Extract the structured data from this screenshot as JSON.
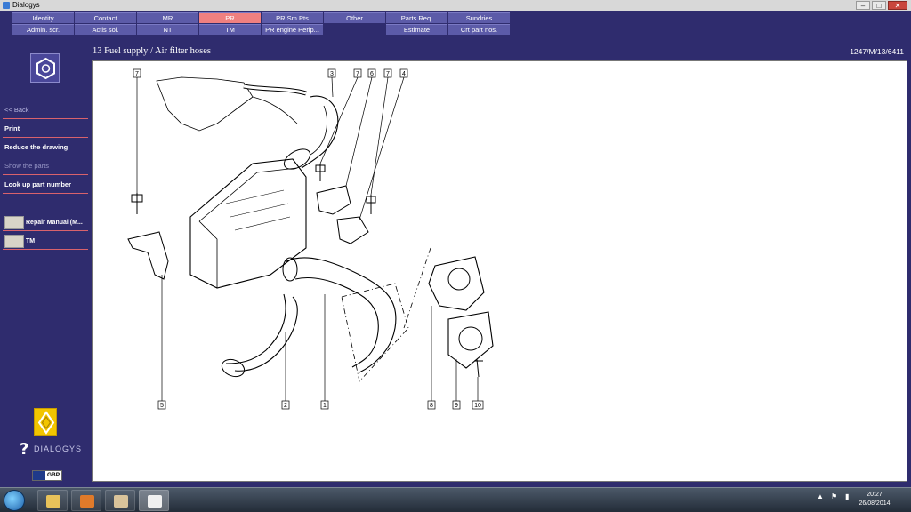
{
  "window": {
    "title": "Dialogys",
    "controls": [
      "–",
      "□",
      "✕"
    ]
  },
  "menu": {
    "row1": [
      {
        "label": "Identity",
        "active": false
      },
      {
        "label": "Contact",
        "active": false
      },
      {
        "label": "MR",
        "active": false
      },
      {
        "label": "PR",
        "active": true
      },
      {
        "label": "PR Sm Pts",
        "active": false
      },
      {
        "label": "Other",
        "active": false
      },
      {
        "label": "Parts Req.",
        "active": false
      },
      {
        "label": "Sundries",
        "active": false
      }
    ],
    "row2": [
      {
        "label": "Admin. scr."
      },
      {
        "label": "Actis sol."
      },
      {
        "label": "NT"
      },
      {
        "label": "TM"
      },
      {
        "label": "PR engine Perip..."
      },
      {
        "label": ""
      },
      {
        "label": "Estimate"
      },
      {
        "label": "Crt part nos."
      }
    ]
  },
  "sidebar": {
    "logo_icon": "hexagon-bolt-icon",
    "items": [
      {
        "label": "<< Back",
        "state": "back"
      },
      {
        "label": "Print",
        "state": "enabled"
      },
      {
        "label": "Reduce the drawing",
        "state": "enabled"
      },
      {
        "label": "Show the parts",
        "state": "disabled"
      },
      {
        "label": "Look up part number",
        "state": "enabled"
      }
    ],
    "tools": [
      {
        "label": "Repair Manual (M...",
        "icon": "repair-manual-icon"
      },
      {
        "label": "TM",
        "icon": "tm-icon"
      }
    ]
  },
  "header": {
    "title": "13 Fuel supply / Air filter hoses",
    "reference": "1247/M/13/6411"
  },
  "drawing": {
    "callouts_top": [
      "7",
      "3",
      "7",
      "6",
      "7",
      "4"
    ],
    "callouts_bottom": [
      "5",
      "2",
      "1",
      "8",
      "9",
      "10"
    ]
  },
  "brand": {
    "logo_text": "DIALOGYS",
    "currency": "GBP"
  },
  "taskbar": {
    "clock_time": "20:27",
    "clock_date": "26/08/2014"
  },
  "colors": {
    "background": "#2f2c6e",
    "menu_button": "#5c5ba8",
    "menu_active": "#f08080",
    "divider": "#d9626c"
  }
}
